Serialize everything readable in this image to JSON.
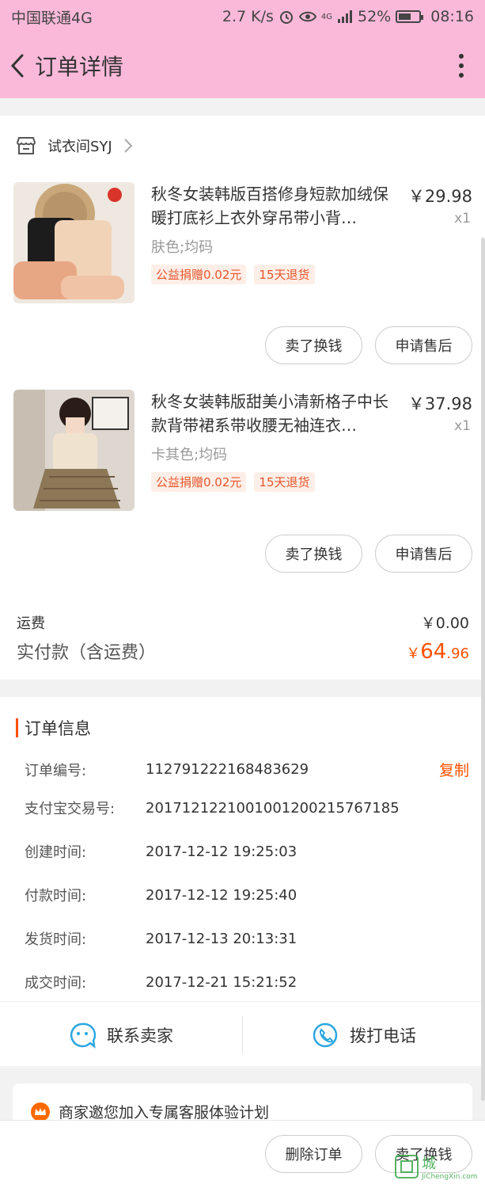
{
  "statusbar": {
    "carrier": "中国联通4G",
    "speed": "2.7 K/s",
    "network": "4G",
    "battery": "52%",
    "time": "08:16"
  },
  "nav": {
    "title": "订单详情"
  },
  "shop": {
    "name": "试衣间SYJ"
  },
  "items": [
    {
      "title": "秋冬女装韩版百搭修身短款加绒保暖打底衫上衣外穿吊带小背…",
      "price": "￥29.98",
      "qty": "x1",
      "sku": "肤色;均码",
      "tags": [
        "公益捐赠0.02元",
        "15天退货"
      ],
      "btn_sell": "卖了换钱",
      "btn_after": "申请售后"
    },
    {
      "title": "秋冬女装韩版甜美小清新格子中长款背带裙系带收腰无袖连衣…",
      "price": "￥37.98",
      "qty": "x1",
      "sku": "卡其色;均码",
      "tags": [
        "公益捐赠0.02元",
        "15天退货"
      ],
      "btn_sell": "卖了换钱",
      "btn_after": "申请售后"
    }
  ],
  "fees": {
    "shipping_label": "运费",
    "shipping_value": "￥0.00",
    "paid_label": "实付款（含运费）",
    "paid_currency": "￥",
    "paid_int": "64",
    "paid_dec": ".96"
  },
  "order_info": {
    "title": "订单信息",
    "copy_label": "复制",
    "rows": [
      {
        "k": "订单编号:",
        "v": "112791222168483629"
      },
      {
        "k": "支付宝交易号:",
        "v": "2017121221001001200215767185"
      },
      {
        "k": "创建时间:",
        "v": "2017-12-12 19:25:03"
      },
      {
        "k": "付款时间:",
        "v": "2017-12-12 19:25:40"
      },
      {
        "k": "发货时间:",
        "v": "2017-12-13 20:13:31"
      },
      {
        "k": "成交时间:",
        "v": "2017-12-21 15:21:52"
      }
    ]
  },
  "contact": {
    "seller": "联系卖家",
    "call": "拨打电话"
  },
  "invite": {
    "text": "商家邀您加入专属客服体验计划"
  },
  "bottom": {
    "delete": "删除订单",
    "sell": "卖了换钱"
  },
  "watermark": {
    "line1": "城",
    "line2": "JiChengXin.com"
  },
  "colors": {
    "header": "#fbb9da",
    "accent": "#ff5000"
  }
}
